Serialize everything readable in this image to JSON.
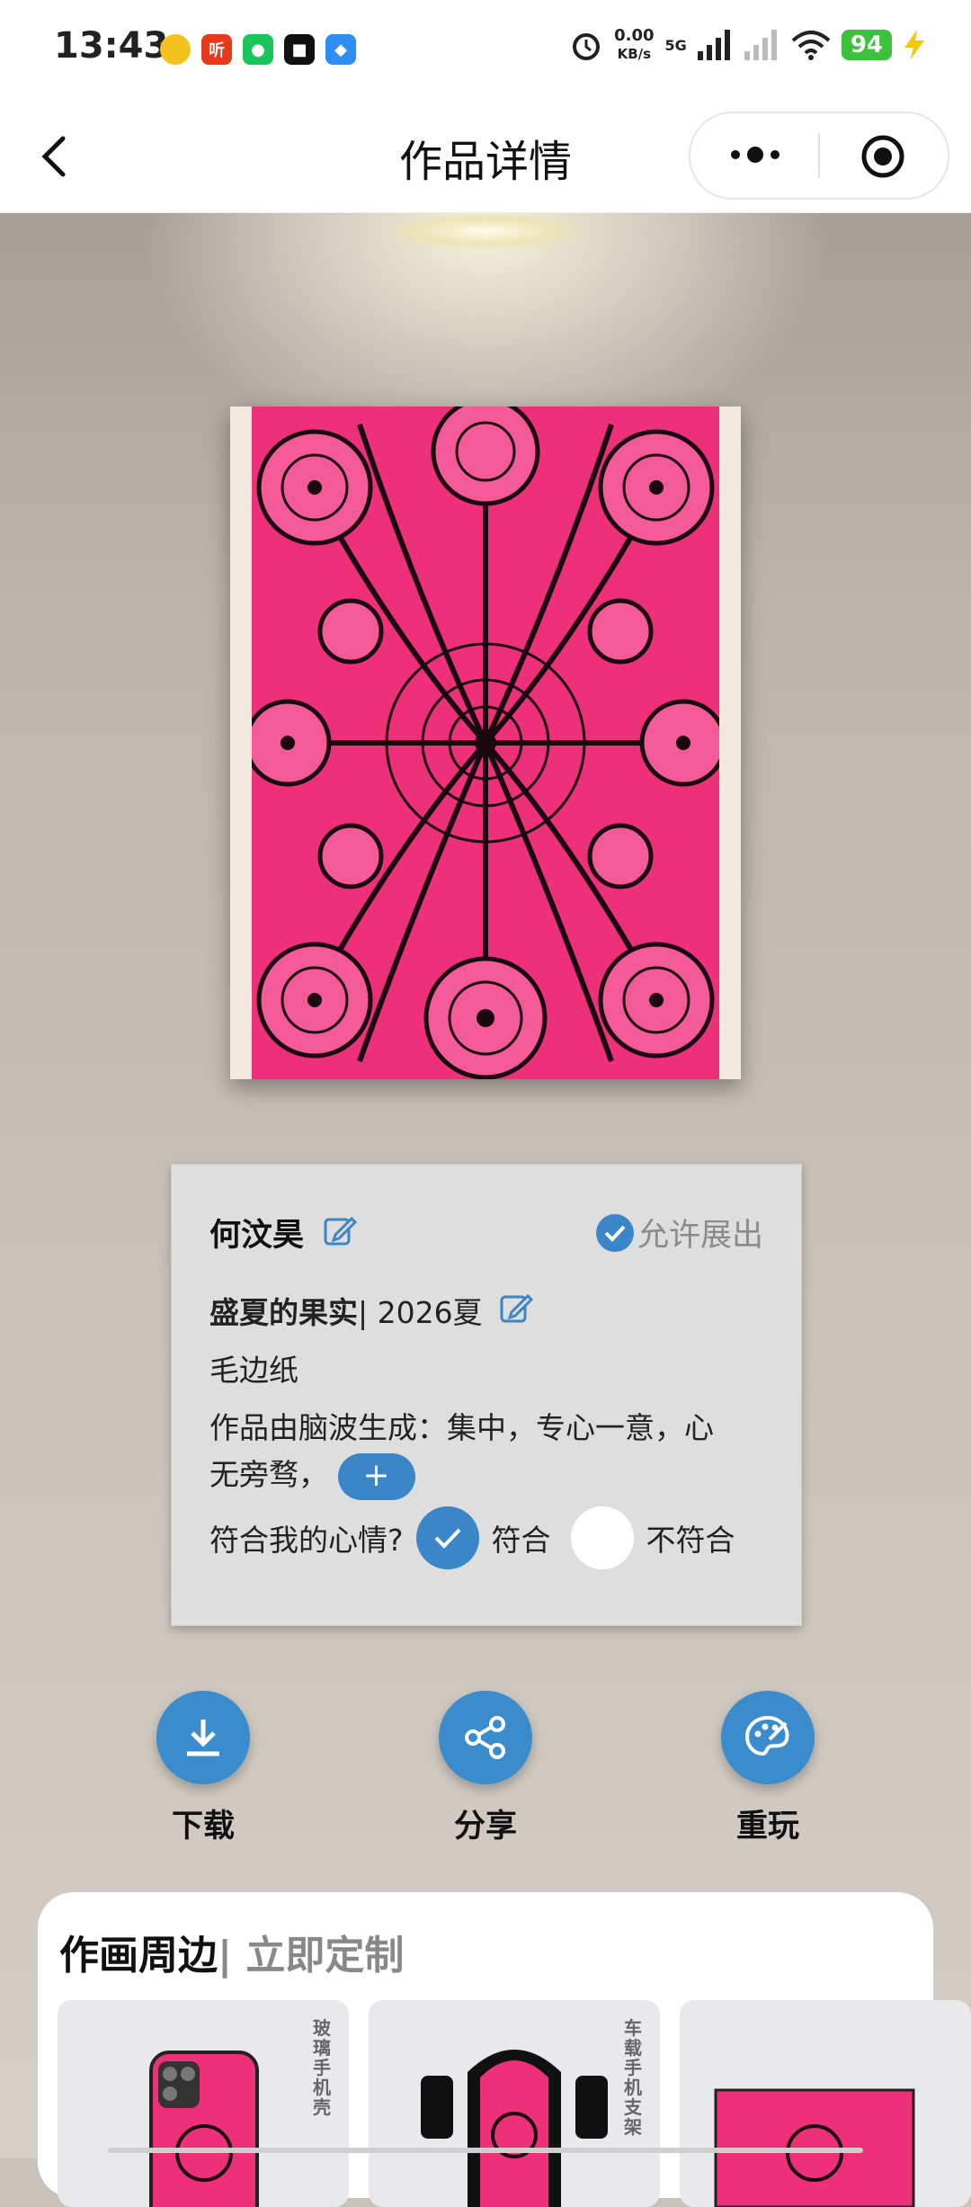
{
  "status_bar": {
    "time": "13:43",
    "net_speed": "0.00",
    "net_unit": "KB/s",
    "network": "5G",
    "battery": "94"
  },
  "nav": {
    "title": "作品详情",
    "back_icon": "chevron-left-icon",
    "more_icon": "more-dots-icon",
    "target_icon": "target-icon"
  },
  "card": {
    "artist": "何汶昊",
    "allow_label": "允许展出",
    "title": "盛夏的果实",
    "title_suffix": "| 2026夏",
    "paper": "毛边纸",
    "desc_line1": "作品由脑波生成：集中，专心一意，心",
    "desc_line2": "无旁骛，",
    "plus": "+",
    "mood_question": "符合我的心情?",
    "mood_yes": "符合",
    "mood_no": "不符合",
    "mood_selected": "符合"
  },
  "actions": [
    {
      "label": "下载",
      "icon": "download-icon"
    },
    {
      "label": "分享",
      "icon": "share-icon"
    },
    {
      "label": "重玩",
      "icon": "palette-icon"
    }
  ],
  "panel": {
    "title": "作画周边",
    "subtitle": "| 立即定制",
    "products": [
      {
        "label": "玻璃手机壳"
      },
      {
        "label": "车载手机支架"
      },
      {
        "label": ""
      }
    ]
  },
  "colors": {
    "accent": "#3a86c8",
    "art_pink": "#ee2f7a"
  }
}
